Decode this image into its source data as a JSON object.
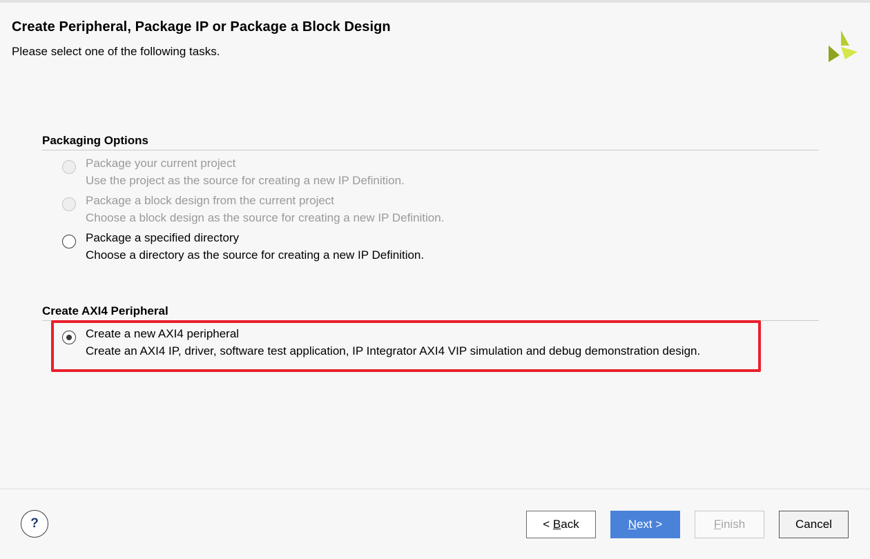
{
  "header": {
    "title": "Create Peripheral, Package IP or Package a Block Design",
    "subtitle": "Please select one of the following tasks."
  },
  "packaging": {
    "heading": "Packaging Options",
    "options": [
      {
        "label": "Package your current project",
        "desc": "Use the project as the source for creating a new IP Definition.",
        "enabled": false,
        "selected": false
      },
      {
        "label": "Package a block design from the current project",
        "desc": "Choose a block design as the source for creating a new IP Definition.",
        "enabled": false,
        "selected": false
      },
      {
        "label": "Package a specified directory",
        "desc": "Choose a directory as the source for creating a new IP Definition.",
        "enabled": true,
        "selected": false
      }
    ]
  },
  "axi": {
    "heading": "Create AXI4 Peripheral",
    "options": [
      {
        "label": "Create a new AXI4 peripheral",
        "desc": "Create an AXI4 IP, driver, software test application, IP Integrator AXI4 VIP simulation and debug demonstration design.",
        "enabled": true,
        "selected": true
      }
    ]
  },
  "footer": {
    "help": "?",
    "back": {
      "pre": "< ",
      "mnemonic": "B",
      "rest": "ack"
    },
    "next": {
      "mnemonic": "N",
      "rest": "ext >"
    },
    "finish": {
      "mnemonic": "F",
      "rest": "inish"
    },
    "cancel": "Cancel"
  },
  "colors": {
    "highlight": "#e8202b",
    "primary_button": "#4a82d9",
    "logo_dark": "#8fa31e",
    "logo_light": "#d6e64a"
  },
  "icons": {
    "logo": "xilinx-logo-icon",
    "help": "help-icon"
  }
}
